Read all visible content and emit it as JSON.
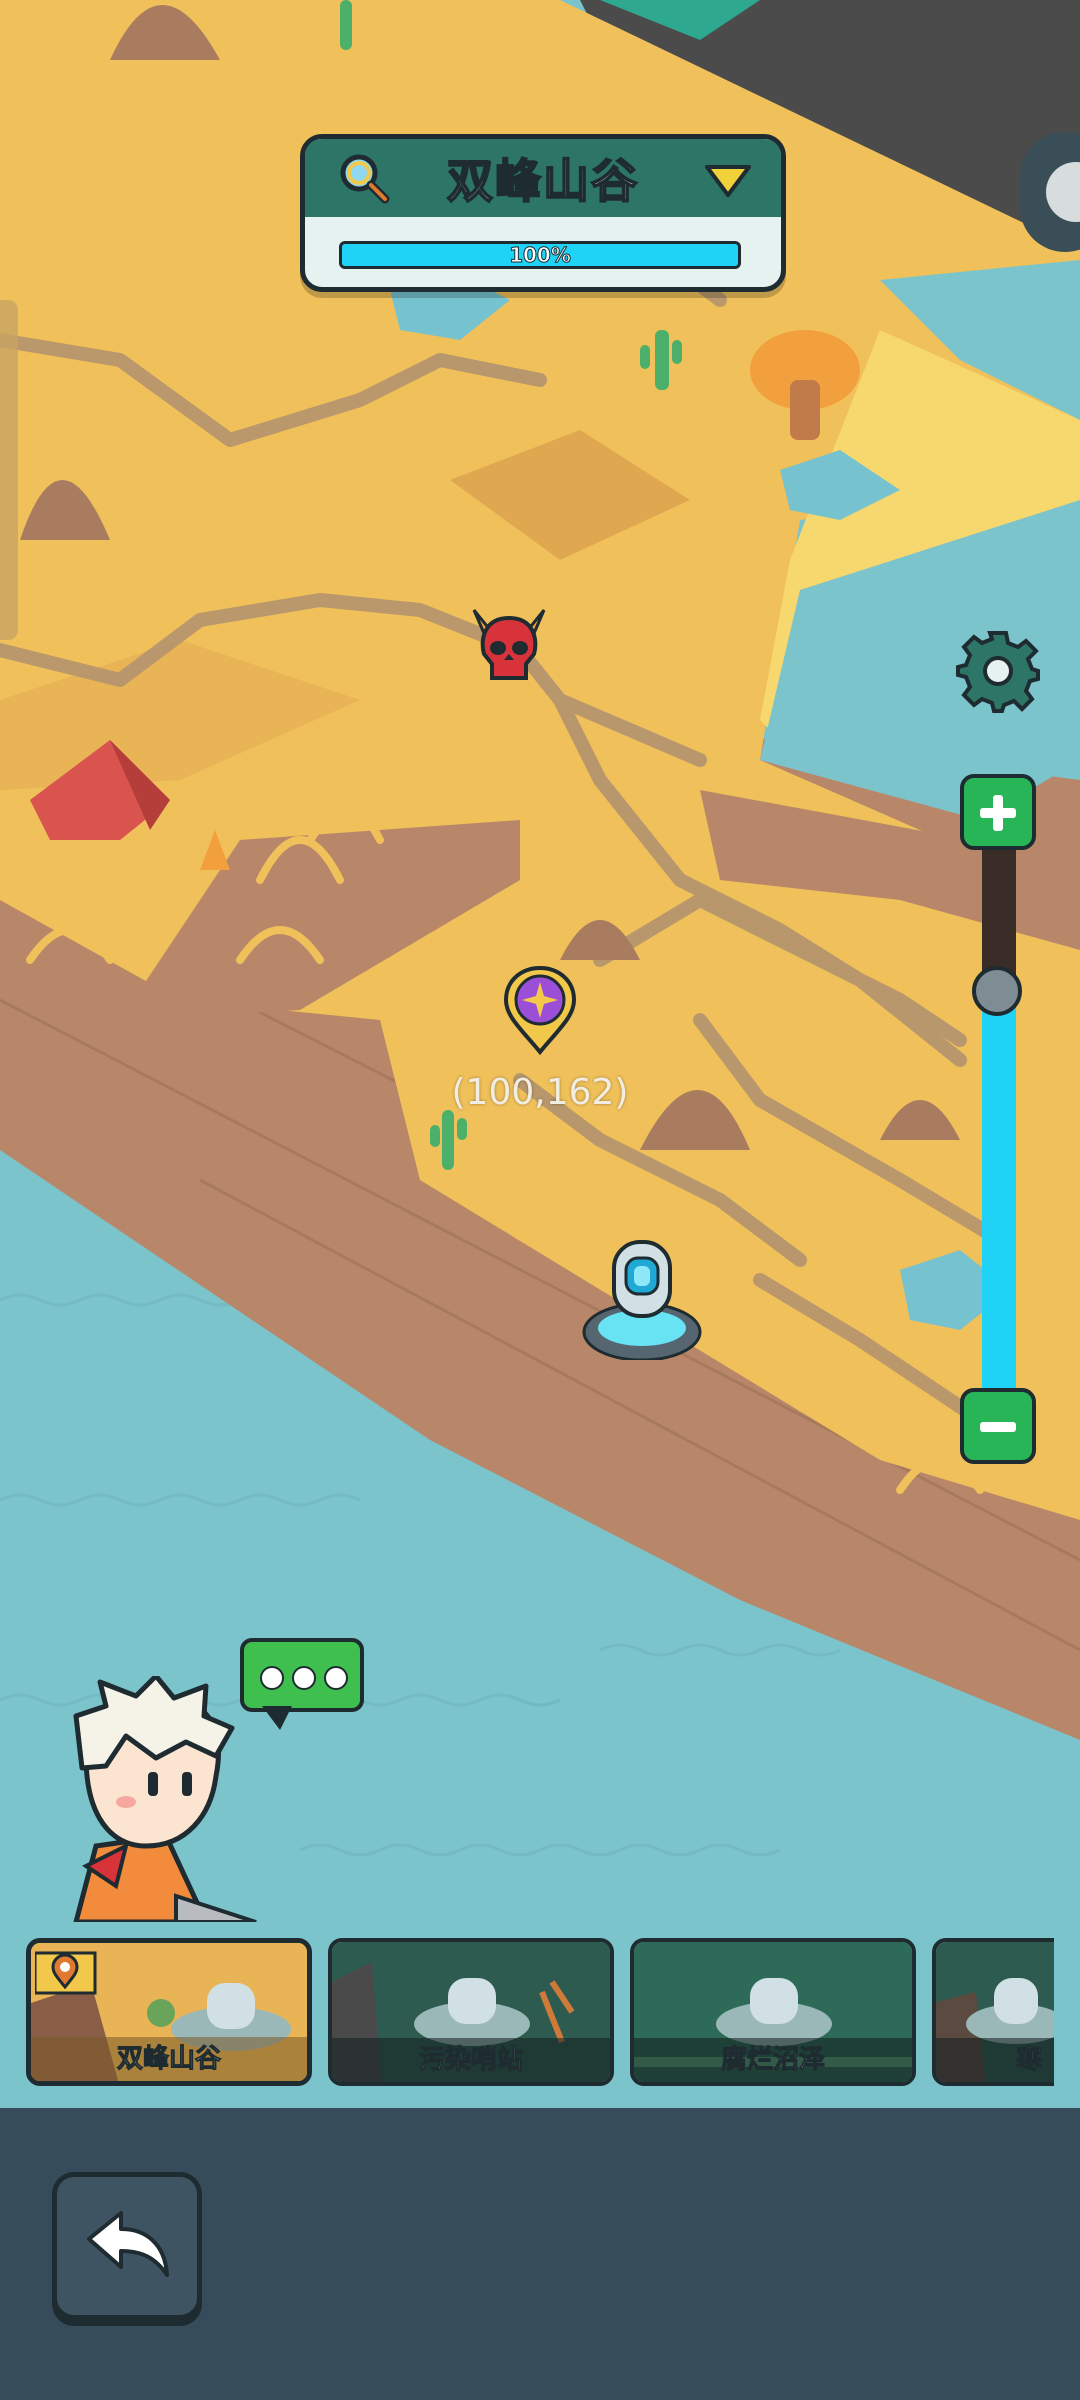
{
  "header": {
    "region_title": "双峰山谷",
    "progress_label": "100%",
    "progress_value": 1.0
  },
  "map": {
    "coordinate_label": "(100,162)",
    "icons": [
      "demon-skull-icon",
      "portal-pin-icon",
      "teleport-stone-icon",
      "cactus-icon",
      "tent-icon",
      "campfire-icon",
      "mushroom-icon"
    ]
  },
  "zoom": {
    "level": 0.27
  },
  "regions": [
    {
      "label": "双峰山谷",
      "selected": true
    },
    {
      "label": "污染哨站",
      "selected": false
    },
    {
      "label": "腐烂沼泽",
      "selected": false
    },
    {
      "label": "寒",
      "selected": false
    }
  ],
  "colors": {
    "sand": "#f0c05a",
    "cliff": "#b8876a",
    "water": "#7cc4cc",
    "accent_green": "#27b557",
    "accent_cyan": "#1ed3f6",
    "panel": "#364c5a"
  }
}
